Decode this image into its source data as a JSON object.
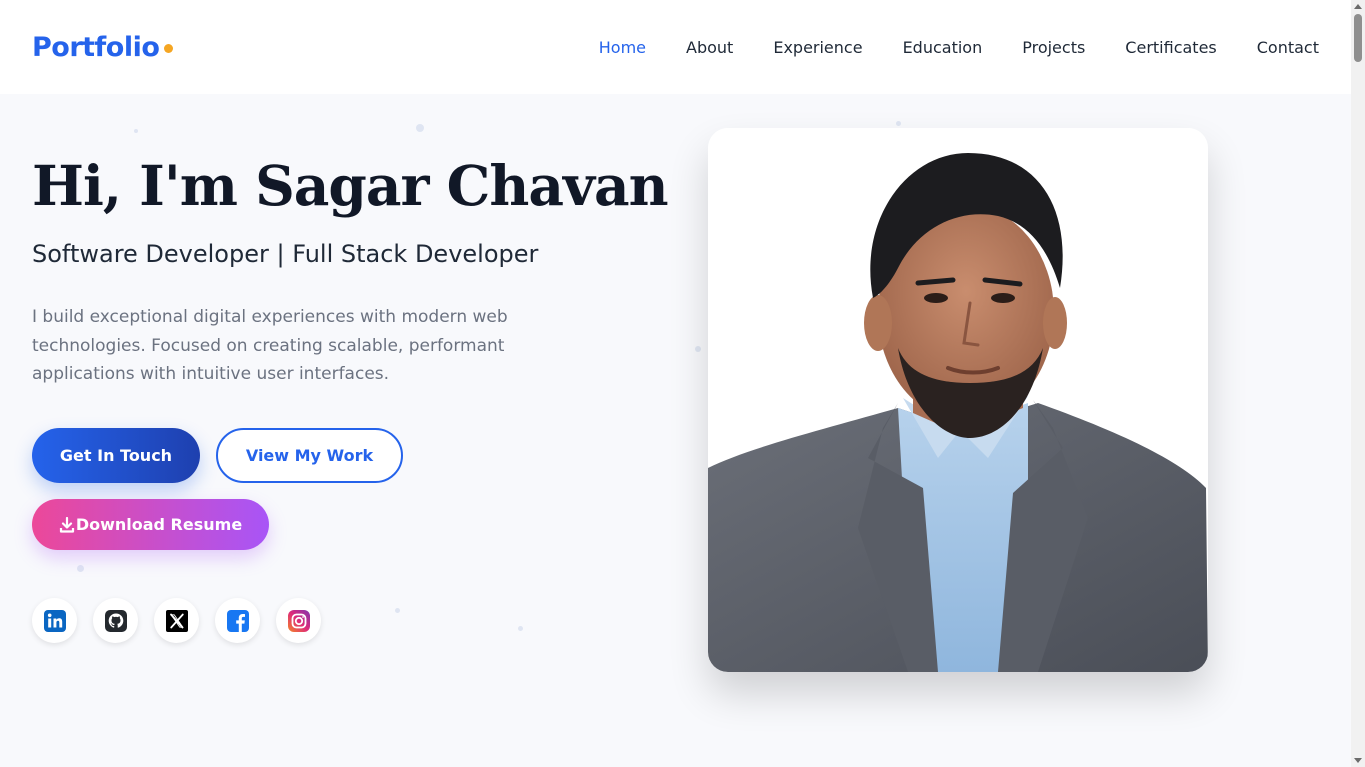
{
  "nav": {
    "logo": "Portfolio",
    "links": [
      "Home",
      "About",
      "Experience",
      "Education",
      "Projects",
      "Certificates",
      "Contact"
    ],
    "active": "Home"
  },
  "hero": {
    "title": "Hi, I'm Sagar Chavan",
    "subtitle": "Software Developer | Full Stack Developer",
    "description": "I build exceptional digital experiences with modern web technologies. Focused on creating scalable, performant applications with intuitive user interfaces.",
    "buttons": {
      "get_in_touch": "Get In Touch",
      "view_work": "View My Work",
      "download_resume": "Download Resume"
    }
  },
  "social": [
    {
      "name": "linkedin-icon",
      "color": "#0a66c2"
    },
    {
      "name": "github-icon",
      "color": "#24292e"
    },
    {
      "name": "x-icon",
      "color": "#000000"
    },
    {
      "name": "facebook-icon",
      "color": "#1877f2"
    },
    {
      "name": "instagram-icon",
      "color": "#e1306c"
    }
  ],
  "profile_image": {
    "icon": "profile-photo"
  },
  "colors": {
    "accent": "#2563eb",
    "logo_dot": "#f5a623",
    "resume_gradient_start": "#ec4899",
    "resume_gradient_end": "#a855f7"
  }
}
